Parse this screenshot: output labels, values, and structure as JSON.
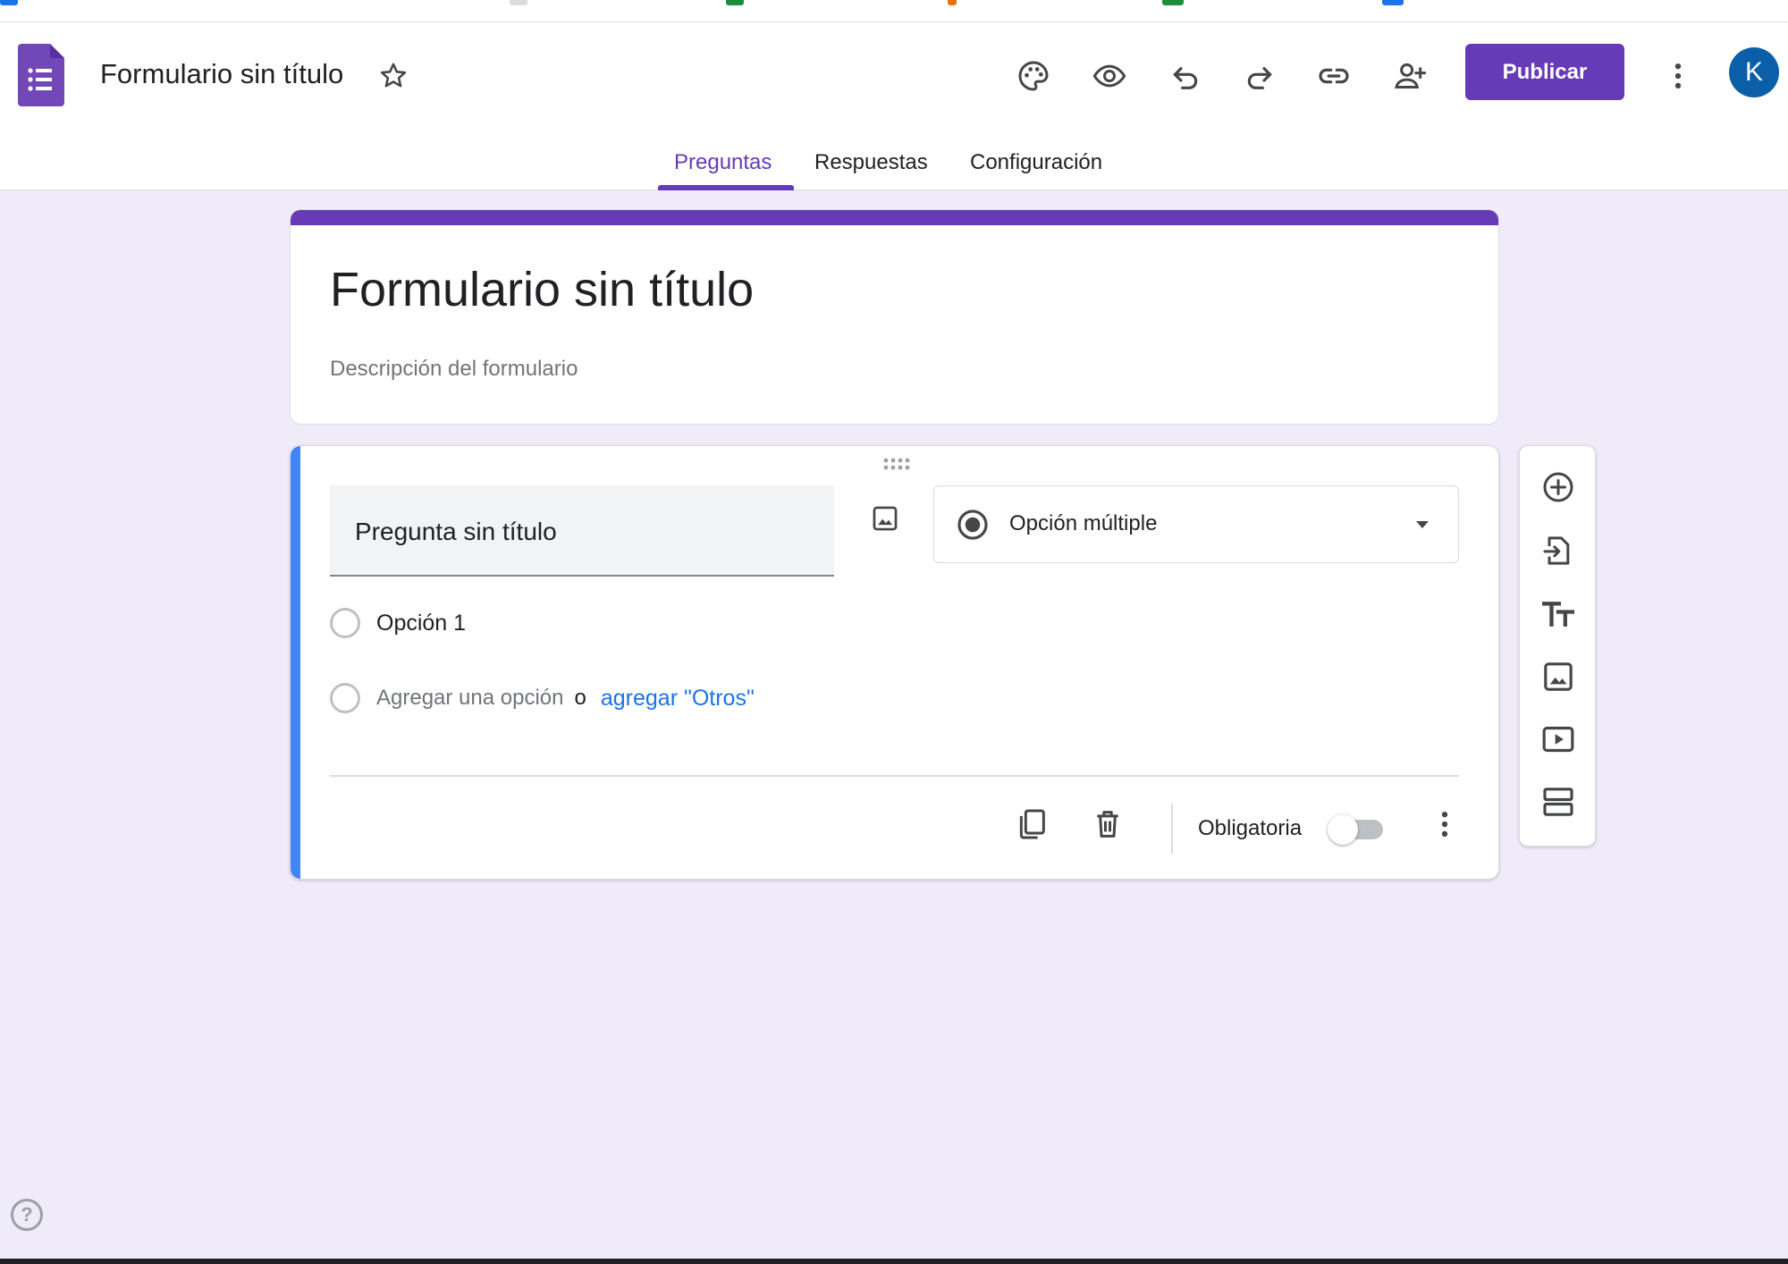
{
  "header": {
    "doc_title": "Formulario sin título",
    "publish_label": "Publicar",
    "avatar_letter": "K",
    "accent_color": "#673ab7"
  },
  "toolbar_icons": [
    "palette-icon",
    "preview-eye-icon",
    "undo-icon",
    "redo-icon",
    "link-icon",
    "add-collaborator-icon",
    "more-vert-icon"
  ],
  "tabs": [
    {
      "label": "Preguntas",
      "active": true
    },
    {
      "label": "Respuestas",
      "active": false
    },
    {
      "label": "Configuración",
      "active": false
    }
  ],
  "form": {
    "title": "Formulario sin título",
    "description_placeholder": "Descripción del formulario"
  },
  "question": {
    "title": "Pregunta sin título",
    "type_label": "Opción múltiple",
    "options": [
      "Opción 1"
    ],
    "add_option_label": "Agregar una opción",
    "or_label": "o",
    "add_other_label": "agregar \"Otros\"",
    "required_label": "Obligatoria",
    "required": false
  },
  "side_toolbar_icons": [
    "add-question-icon",
    "import-questions-icon",
    "add-title-icon",
    "add-image-icon",
    "add-video-icon",
    "add-section-icon"
  ],
  "help_glyph": "?"
}
